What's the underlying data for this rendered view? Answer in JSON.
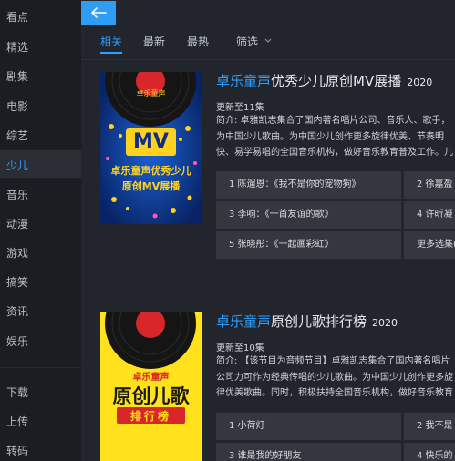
{
  "sidebar": {
    "items": [
      {
        "label": "看点"
      },
      {
        "label": "精选"
      },
      {
        "label": "剧集"
      },
      {
        "label": "电影"
      },
      {
        "label": "综艺"
      },
      {
        "label": "少儿"
      },
      {
        "label": "音乐"
      },
      {
        "label": "动漫"
      },
      {
        "label": "游戏"
      },
      {
        "label": "搞笑"
      },
      {
        "label": "资讯"
      },
      {
        "label": "娱乐"
      },
      {
        "label": "下载"
      },
      {
        "label": "上传"
      },
      {
        "label": "转码"
      }
    ],
    "active": "少儿"
  },
  "header": {
    "back_icon": "arrow-left-icon",
    "tabs": [
      {
        "label": "相关"
      },
      {
        "label": "最新"
      },
      {
        "label": "最热"
      },
      {
        "label": "筛选"
      }
    ],
    "active_tab": "相关"
  },
  "cards": [
    {
      "brand": "卓乐童声",
      "title": "优秀少儿原创MV展播",
      "year": "2020",
      "update": "更新至11集",
      "intro": "简介: 卓雅凯志集合了国内著名唱片公司、音乐人、歌手，为中国少儿歌曲。为中国少儿创作更多旋律优美、节奏明快、易学易唱的全国音乐机构，做好音乐教育普及工作。儿童歌曲创作的繁荣",
      "cover": {
        "brand": "卓乐童声",
        "big": "MV",
        "line1": "卓乐童声优秀少儿",
        "line2": "原创MV展播"
      },
      "episodes": [
        "1 陈遛恩：《我不是你的宠物狗》",
        "2 徐嘉盈",
        "3 李响：《一首友谊的歌》",
        "4 许昕凝",
        "5 张晓彤：《一起画彩虹》",
        "更多选集("
      ]
    },
    {
      "brand": "卓乐童声",
      "title": "原创儿歌排行榜",
      "year": "2020",
      "update": "更新至10集",
      "intro": "简介: 【该节目为音频节目】卓雅凯志集合了国内著名唱片公司力可作为经典传唱的少儿歌曲。为中国少儿创作更多旋律优美歌曲。同时，积极扶持全国音乐机构，做好音乐教育普及工",
      "cover": {
        "brand": "卓乐童声",
        "big": "原创儿歌",
        "tag": "排行榜"
      },
      "episodes": [
        "1 小荷灯",
        "2 我不是",
        "3 谁是我的好朋友",
        "4 快乐的"
      ]
    }
  ],
  "colors": {
    "accent": "#2e9fff",
    "bg": "#22252b",
    "sidebar_bg": "#1b1d22",
    "episode_bg": "#34373d"
  }
}
